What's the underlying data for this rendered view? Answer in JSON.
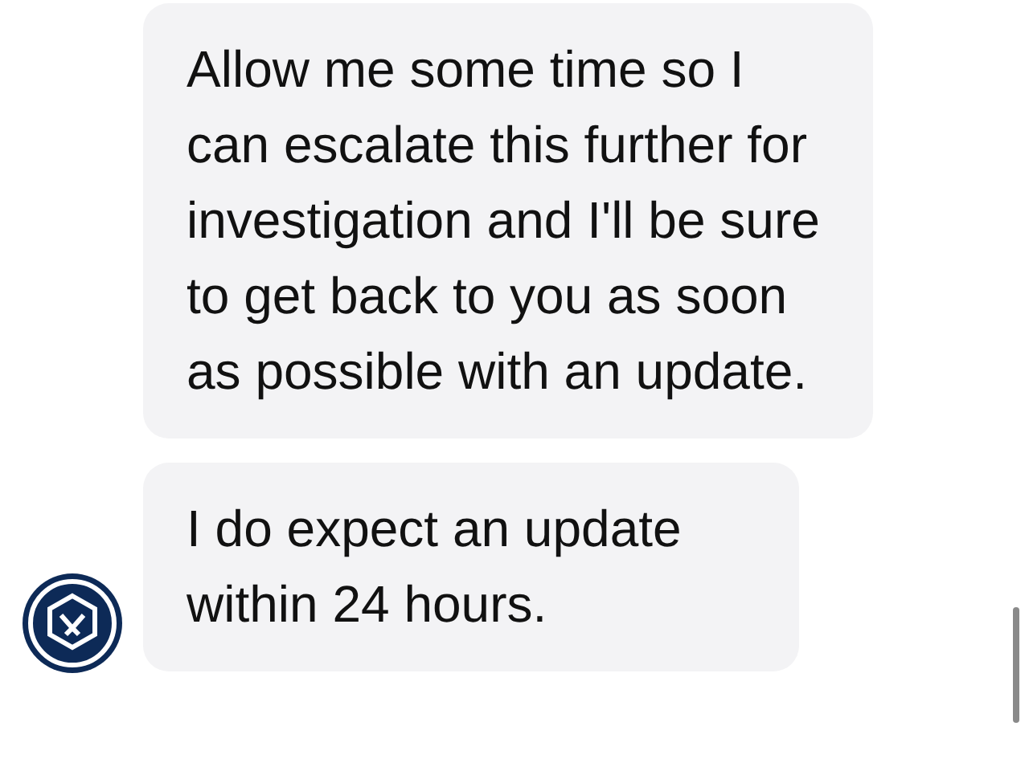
{
  "messages": [
    {
      "text": "Allow me some time so I can escalate this further for investigation and I'll be sure to get back to you as soon as possible with an update.",
      "show_avatar": false
    },
    {
      "text": "I do expect an update within 24 hours.",
      "show_avatar": true
    }
  ]
}
